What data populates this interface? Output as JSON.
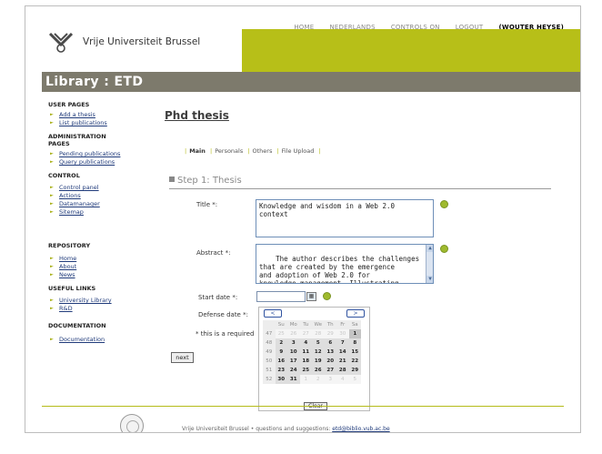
{
  "topnav": {
    "items": [
      "HOME",
      "NEDERLANDS",
      "CONTROLS ON",
      "LOGOUT"
    ],
    "user": "(WOUTER HEYSE)"
  },
  "header": {
    "brand": "Vrije Universiteit Brussel",
    "title": "Library : ETD",
    "accent_color": "#b7bf18",
    "bar_color": "#7d7a6c"
  },
  "sidebar": {
    "sections": [
      {
        "title": "USER PAGES",
        "items": [
          "Add a thesis",
          "List publications"
        ]
      },
      {
        "title": "ADMINISTRATION PAGES",
        "items": [
          "Pending publications",
          "Query publications"
        ]
      },
      {
        "title": "CONTROL",
        "items": [
          "Control panel",
          "Actions",
          "Datamanager",
          "Sitemap"
        ]
      },
      {
        "title": "REPOSITORY",
        "items": [
          "Home",
          "About",
          "News"
        ]
      },
      {
        "title": "USEFUL LINKS",
        "items": [
          "University Library",
          "R&D"
        ]
      },
      {
        "title": "DOCUMENTATION",
        "items": [
          "Documentation"
        ]
      }
    ]
  },
  "main": {
    "page_title": "Phd thesis",
    "tabs": [
      "Main",
      "Personals",
      "Others",
      "File Upload"
    ],
    "step_title": "Step 1: Thesis",
    "title_label": "Title *:",
    "title_value": "Knowledge and wisdom in a Web 2.0\ncontext",
    "abstract_label": "Abstract *:",
    "abstract_value": "The author describes the challenges\nthat are created by the emergence\nand adoption of Web 2.0 for\nknowledge management. Illustrating",
    "start_label": "Start date *:",
    "defense_label": "Defense date *:",
    "required_note": "* this is a required",
    "next_label": "next"
  },
  "calendar": {
    "prev": "<",
    "next": ">",
    "headers": [
      "",
      "Su",
      "Mo",
      "Tu",
      "We",
      "Th",
      "Fr",
      "Sa"
    ],
    "rows": [
      [
        "47",
        "25",
        "26",
        "27",
        "28",
        "29",
        "30",
        "1"
      ],
      [
        "48",
        "2",
        "3",
        "4",
        "5",
        "6",
        "7",
        "8"
      ],
      [
        "49",
        "9",
        "10",
        "11",
        "12",
        "13",
        "14",
        "15"
      ],
      [
        "50",
        "16",
        "17",
        "18",
        "19",
        "20",
        "21",
        "22"
      ],
      [
        "51",
        "23",
        "24",
        "25",
        "26",
        "27",
        "28",
        "29"
      ],
      [
        "52",
        "30",
        "31",
        "1",
        "2",
        "3",
        "4",
        "5"
      ]
    ],
    "clear": "Clear"
  },
  "footer": {
    "text": "Vrije Universiteit Brussel • questions and suggestions: ",
    "email": "etd@biblio.vub.ac.be"
  }
}
